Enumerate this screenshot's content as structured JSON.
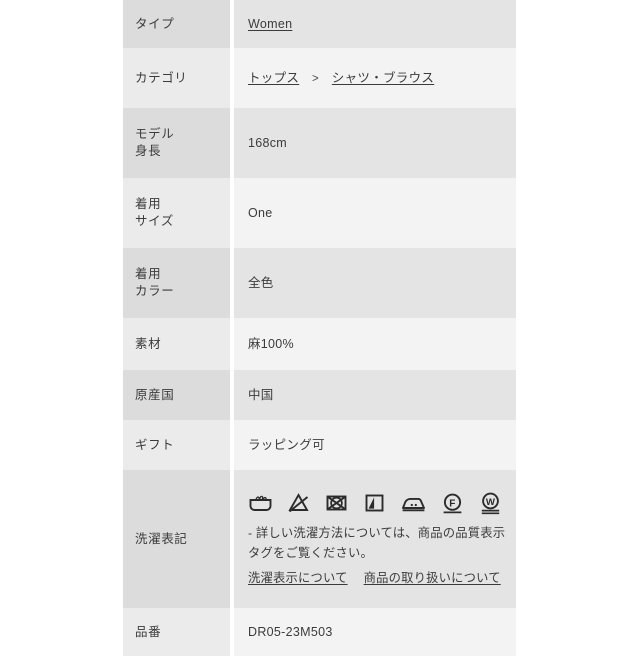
{
  "product_spec": {
    "rows": [
      {
        "label": "タイプ",
        "type": "link",
        "value": "Women"
      },
      {
        "label": "カテゴリ",
        "type": "breadcrumb",
        "crumb1": "トップス",
        "separator": ">",
        "crumb2": "シャツ・ブラウス"
      },
      {
        "label": "モデル\n身長",
        "type": "text",
        "value": "168cm"
      },
      {
        "label": "着用\nサイズ",
        "type": "text",
        "value": "One"
      },
      {
        "label": "着用\nカラー",
        "type": "text",
        "value": "全色"
      },
      {
        "label": "素材",
        "type": "text",
        "value": "麻100%"
      },
      {
        "label": "原産国",
        "type": "text",
        "value": "中国"
      },
      {
        "label": "ギフト",
        "type": "text",
        "value": "ラッピング可"
      },
      {
        "label": "洗濯表記",
        "type": "care",
        "note": "- 詳しい洗濯方法については、商品の品質表示タグをご覧ください。",
        "link1": "洗濯表示について",
        "link2": "商品の取り扱いについて",
        "icons": [
          "hand-wash-tub-icon",
          "do-not-bleach-triangle-icon",
          "do-not-tumble-dry-icon",
          "line-dry-in-shade-icon",
          "iron-low-heat-icon",
          "dry-clean-petroleum-f-icon",
          "wet-clean-gentle-w-icon"
        ]
      },
      {
        "label": "品番",
        "type": "text",
        "value": "DR05-23M503"
      }
    ]
  },
  "colors": {
    "page_background": "#ffffff",
    "row_dark_label": "#dcdcdc",
    "row_dark_value": "#e4e4e4",
    "row_light_label": "#ebebeb",
    "row_light_value": "#f3f3f3",
    "text": "#3b3b3b",
    "icon_stroke": "#2b2b2b"
  }
}
